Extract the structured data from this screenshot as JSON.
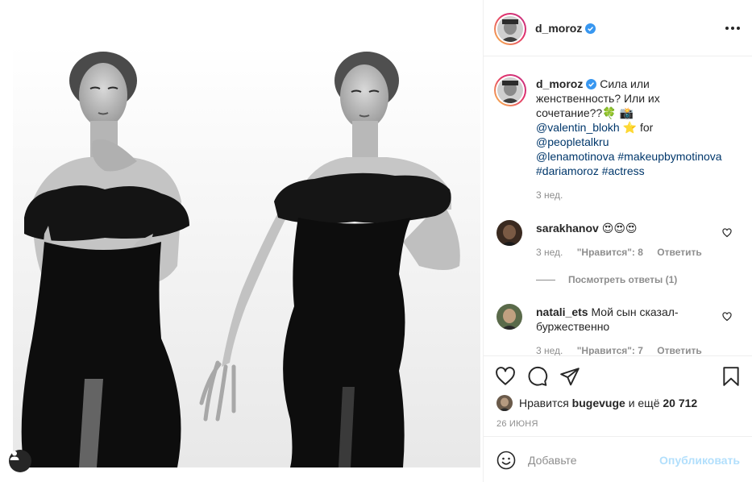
{
  "post": {
    "author": "d_moroz",
    "verified": true,
    "caption": {
      "text_line1": "Сила или",
      "text_line2": "женственность? Или их",
      "text_line3": "сочетание??🍀 📸",
      "mention1": "@valentin_blokh",
      "star": "⭐",
      "for_word": "for",
      "mention2": "@peopletalkru",
      "mention3": "@lenamotinova",
      "hashtag1": "#makeupbymotinova",
      "hashtag2": "#dariamoroz",
      "hashtag3": "#actress",
      "time": "3 нед."
    },
    "comments": [
      {
        "user": "sarakhanov",
        "text": "😍😍😍",
        "time": "3 нед.",
        "likes": "\"Нравится\": 8",
        "reply": "Ответить",
        "view_replies": "Посмотреть ответы (1)"
      },
      {
        "user": "natali_ets",
        "text": "Мой сын сказал- буржественно",
        "time": "3 нед.",
        "likes": "\"Нравится\": 7",
        "reply": "Ответить"
      }
    ],
    "likes_prefix": "Нравится",
    "likes_user": "bugevuge",
    "likes_middle": "и ещё",
    "likes_count": "20 712",
    "date": "26 ИЮНЯ"
  },
  "composer": {
    "placeholder": "Добавьте",
    "publish_label": "Опубликовать"
  },
  "icons": {
    "tag": "user-tag-icon",
    "more": "more-options-icon",
    "like": "heart-icon",
    "comment": "comment-icon",
    "share": "share-icon",
    "save": "bookmark-icon",
    "emoji": "emoji-icon"
  },
  "colors": {
    "link": "#00376b",
    "verified": "#3897f0",
    "secondary": "#8e8e8e",
    "publish_disabled": "#b2dffc"
  }
}
